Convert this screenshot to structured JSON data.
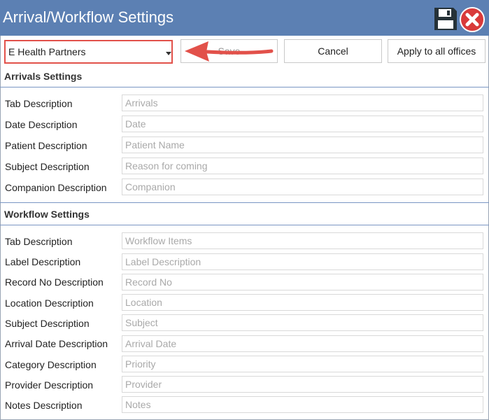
{
  "window": {
    "title": "Arrival/Workflow Settings"
  },
  "toolbar": {
    "office_selected": "E Health Partners",
    "save_label": "Save",
    "cancel_label": "Cancel",
    "apply_label": "Apply to all offices"
  },
  "annotation": {
    "color": "#e2514a"
  },
  "arrivals": {
    "title": "Arrivals Settings",
    "fields": [
      {
        "label": "Tab Description",
        "placeholder": "Arrivals"
      },
      {
        "label": "Date Description",
        "placeholder": "Date"
      },
      {
        "label": "Patient Description",
        "placeholder": "Patient Name"
      },
      {
        "label": "Subject Description",
        "placeholder": "Reason for coming"
      },
      {
        "label": "Companion Description",
        "placeholder": "Companion"
      }
    ]
  },
  "workflow": {
    "title": "Workflow Settings",
    "fields": [
      {
        "label": "Tab Description",
        "placeholder": "Workflow Items"
      },
      {
        "label": "Label Description",
        "placeholder": "Label Description"
      },
      {
        "label": "Record No Description",
        "placeholder": "Record No"
      },
      {
        "label": "Location Description",
        "placeholder": "Location"
      },
      {
        "label": "Subject Description",
        "placeholder": "Subject"
      },
      {
        "label": "Arrival Date Description",
        "placeholder": "Arrival Date"
      },
      {
        "label": "Category Description",
        "placeholder": "Priority"
      },
      {
        "label": "Provider Description",
        "placeholder": "Provider"
      },
      {
        "label": "Notes Description",
        "placeholder": "Notes"
      }
    ]
  },
  "theme": {
    "titlebar": "#5c80b3",
    "section_line": "#7a96c3"
  }
}
